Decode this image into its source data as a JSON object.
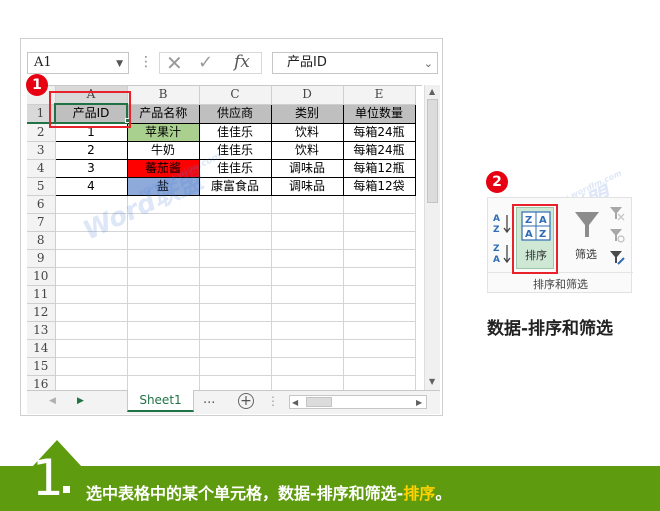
{
  "excel": {
    "namebox": "A1",
    "formula_sep": "⋮",
    "formula_value": "产品ID",
    "columns": [
      "A",
      "B",
      "C",
      "D",
      "E"
    ],
    "row_numbers": [
      "1",
      "2",
      "3",
      "4",
      "5",
      "6",
      "7",
      "8",
      "9",
      "10",
      "11",
      "12",
      "13",
      "14",
      "15",
      "16"
    ],
    "rows": [
      [
        "产品ID",
        "产品名称",
        "供应商",
        "类别",
        "单位数量"
      ],
      [
        "1",
        "苹果汁",
        "佳佳乐",
        "饮料",
        "每箱24瓶"
      ],
      [
        "2",
        "牛奶",
        "佳佳乐",
        "饮料",
        "每箱24瓶"
      ],
      [
        "3",
        "蕃茄酱",
        "佳佳乐",
        "调味品",
        "每箱12瓶"
      ],
      [
        "4",
        "盐",
        "康富食品",
        "调味品",
        "每箱12袋"
      ]
    ],
    "sheet_tab": "Sheet1",
    "tab_more": "...",
    "colors": {
      "header_fill": "#bfbfbf",
      "green": "#a9d08e",
      "red": "#ff0000",
      "blue": "#8eaadb",
      "excel_green": "#217346"
    }
  },
  "callouts": {
    "one": "1",
    "two": "2"
  },
  "ribbon": {
    "sort_label": "排序",
    "filter_label": "筛选",
    "group_label": "排序和筛选"
  },
  "caption": "数据-排序和筛选",
  "watermark": {
    "text": "Word联盟",
    "url": "www.wordlm.com"
  },
  "banner": {
    "step": "1",
    "text_main": "选中表格中的某个单元格，数据-排序和筛选-",
    "text_highlight": "排序",
    "text_end": "。",
    "color": "#5f9b0e",
    "highlight_color": "#ffd200"
  }
}
